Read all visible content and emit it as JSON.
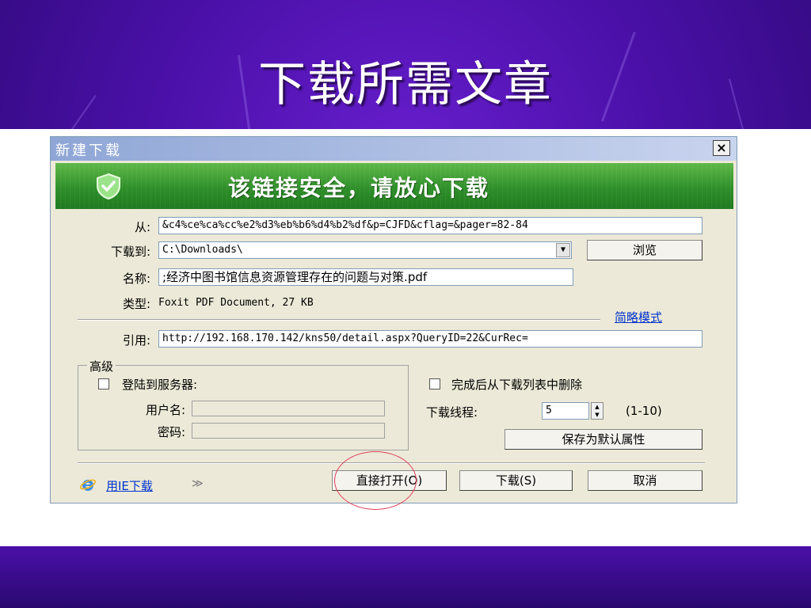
{
  "slide": {
    "title": "下载所需文章",
    "colors": {
      "background": "#4a10a8",
      "title_text": "#ffffff",
      "annotation_circle": "#e0405a"
    }
  },
  "dialog": {
    "title": "新建下载",
    "close_glyph": "×",
    "banner": {
      "text": "该链接安全，请放心下载",
      "icon": "shield-check-icon",
      "color": "#2f8f2a"
    },
    "from": {
      "label": "从:",
      "value": "&c4%ce%ca%cc%e2%d3%eb%b6%d4%b2%df&p=CJFD&cflag=&pager=82-84"
    },
    "save_to": {
      "label": "下载到:",
      "value": "C:\\Downloads\\",
      "browse_label": "浏览"
    },
    "name": {
      "label": "名称:",
      "value": ";经济中图书馆信息资源管理存在的问题与对策.pdf"
    },
    "type": {
      "label": "类型:",
      "value": "Foxit PDF Document, 27 KB"
    },
    "simple_mode_link": "简略模式",
    "referer": {
      "label": "引用:",
      "value": "http://192.168.170.142/kns50/detail.aspx?QueryID=22&CurRec="
    },
    "advanced": {
      "legend": "高级",
      "login_checkbox_label": "登陆到服务器:",
      "login_checked": false,
      "username_label": "用户名:",
      "password_label": "密码:"
    },
    "delete_after_label": "完成后从下载列表中删除",
    "delete_after_checked": false,
    "threads": {
      "label": "下载线程:",
      "value": "5",
      "range": "(1-10)"
    },
    "save_default_label": "保存为默认属性",
    "ie_download_link": "用IE下载",
    "open_direct_button": "直接打开(O)",
    "download_button": "下载(S)",
    "cancel_button": "取消"
  }
}
